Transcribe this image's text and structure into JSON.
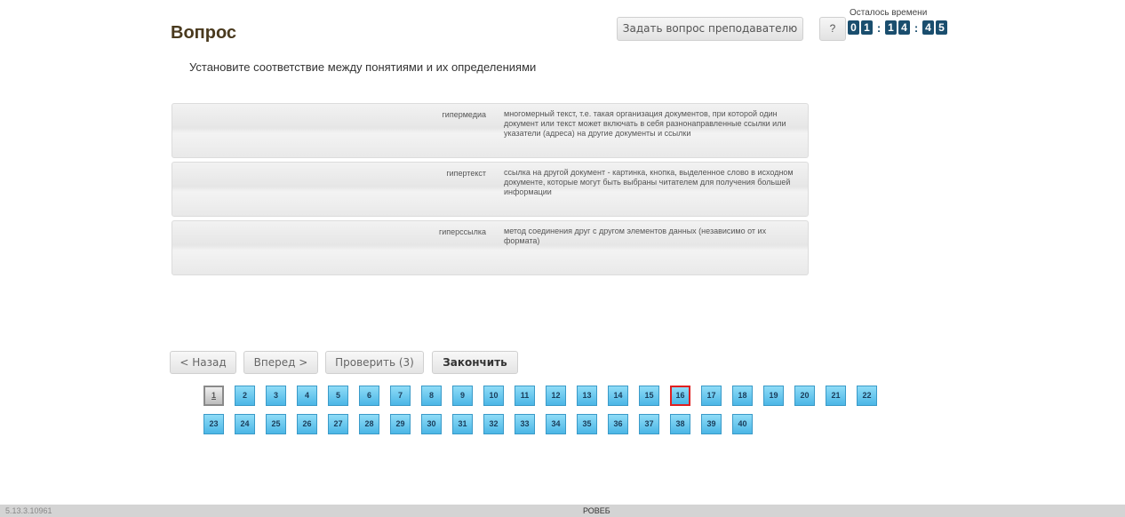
{
  "header": {
    "title": "Вопрос",
    "ask_teacher_label": "Задать вопрос преподавателю",
    "help_label": "?",
    "timer_label": "Осталось времени",
    "timer_digits": [
      "0",
      "1",
      "1",
      "4",
      "4",
      "5"
    ]
  },
  "question": {
    "text": "Установите соответствие между понятиями и их определениями",
    "pairs": [
      {
        "term": "гипермедиа",
        "definition": "многомерный текст, т.е. такая организация документов, при которой один документ или текст может включать в себя разнонаправленные ссылки или указатели (адреса) на другие документы и ссылки"
      },
      {
        "term": "гипертекст",
        "definition": "ссылка на другой документ - картинка, кнопка, выделенное слово в исходном документе, которые могут быть выбраны читателем для получения большей информации"
      },
      {
        "term": "гиперссылка",
        "definition": "метод соединения друг с другом элементов данных (независимо от их формата)"
      }
    ]
  },
  "nav": {
    "back_label": "< Назад",
    "forward_label": "Вперед >",
    "check_label": "Проверить (3)",
    "finish_label": "Закончить"
  },
  "question_nav": {
    "numbers": [
      "1",
      "2",
      "3",
      "4",
      "5",
      "6",
      "7",
      "8",
      "9",
      "10",
      "11",
      "12",
      "13",
      "14",
      "15",
      "16",
      "17",
      "18",
      "19",
      "20",
      "21",
      "22",
      "23",
      "24",
      "25",
      "26",
      "27",
      "28",
      "29",
      "30",
      "31",
      "32",
      "33",
      "34",
      "35",
      "36",
      "37",
      "38",
      "39",
      "40"
    ],
    "current": "1",
    "flagged": "16"
  },
  "footer": {
    "version": "5.13.3.10961",
    "center_text": "РОВЕБ"
  }
}
